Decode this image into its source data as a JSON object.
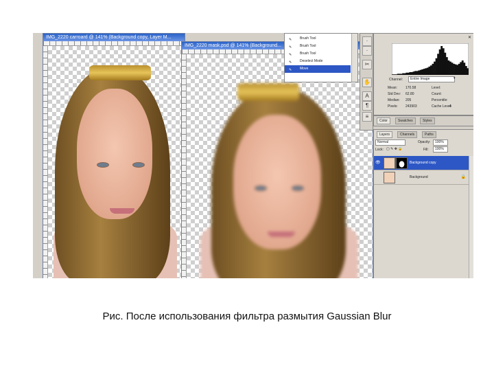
{
  "window_left": {
    "title": "IMG_2220 carroard @ 141% (Background copy, Layer M..."
  },
  "window_right": {
    "title": "IMG_2220 mask.psd @ 141% (Background..."
  },
  "tool_presets": {
    "items": [
      {
        "label": "Brush Tool"
      },
      {
        "label": "Brush Tool"
      },
      {
        "label": "Brush Tool"
      },
      {
        "label": "Deselect Mode"
      },
      {
        "label": "Move"
      }
    ],
    "selected_index": 4
  },
  "histogram": {
    "channel_label": "Channel:",
    "channel_value": "Entire Image",
    "stats": [
      {
        "label": "Mean:",
        "value": "170.58"
      },
      {
        "label": "Std Dev:",
        "value": "62.80"
      },
      {
        "label": "Median:",
        "value": "205"
      },
      {
        "label": "Pixels:",
        "value": "243903"
      },
      {
        "label": "Level:",
        "value": ""
      },
      {
        "label": "Count:",
        "value": ""
      },
      {
        "label": "Percentile:",
        "value": ""
      },
      {
        "label": "Cache Level:",
        "value": "4"
      }
    ],
    "bars": [
      1,
      1,
      1,
      2,
      2,
      2,
      3,
      3,
      4,
      4,
      5,
      5,
      6,
      7,
      7,
      8,
      9,
      10,
      11,
      12,
      13,
      15,
      17,
      20,
      24,
      30,
      38,
      46,
      52,
      48,
      40,
      32,
      26,
      24,
      22,
      20,
      19,
      18,
      20,
      23,
      26,
      22,
      16,
      12
    ]
  },
  "color_panel": {
    "tabs": [
      "Color",
      "Swatches",
      "Styles"
    ]
  },
  "layers_panel": {
    "tabs": [
      "Layers",
      "Channels",
      "Paths"
    ],
    "blend_mode": "Normal",
    "opacity_label": "Opacity:",
    "opacity_value": "100%",
    "lock_label": "Lock:",
    "fill_label": "Fill:",
    "fill_value": "100%",
    "layers": [
      {
        "name": "Background copy",
        "selected": true
      },
      {
        "name": "Background",
        "selected": false
      }
    ]
  },
  "caption": "Рис. После использования фильтра размытия Gaussian Blur"
}
